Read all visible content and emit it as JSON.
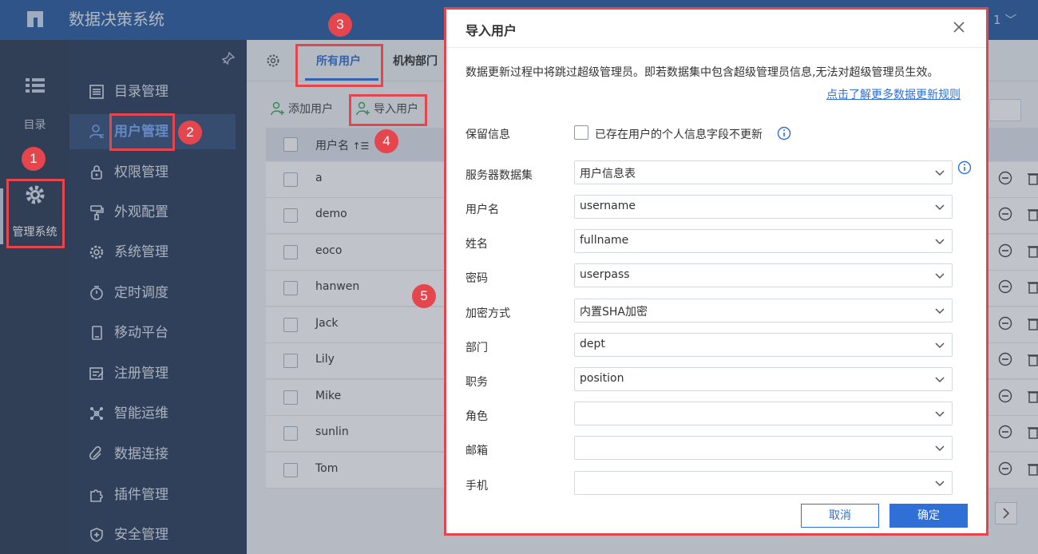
{
  "app": {
    "title": "数据决策系统",
    "user_menu": "1 ﹀"
  },
  "rail": {
    "directory_label": "目录",
    "manage_label": "管理系统"
  },
  "sidebar": {
    "items": [
      {
        "label": "目录管理",
        "icon": "list-icon"
      },
      {
        "label": "用户管理",
        "icon": "user-icon",
        "active": true
      },
      {
        "label": "权限管理",
        "icon": "lock-icon"
      },
      {
        "label": "外观配置",
        "icon": "brush-icon"
      },
      {
        "label": "系统管理",
        "icon": "gear-icon"
      },
      {
        "label": "定时调度",
        "icon": "timer-icon"
      },
      {
        "label": "移动平台",
        "icon": "mobile-icon"
      },
      {
        "label": "注册管理",
        "icon": "register-icon"
      },
      {
        "label": "智能运维",
        "icon": "network-icon"
      },
      {
        "label": "数据连接",
        "icon": "link-icon"
      },
      {
        "label": "插件管理",
        "icon": "puzzle-icon"
      },
      {
        "label": "安全管理",
        "icon": "shield-icon"
      }
    ]
  },
  "main": {
    "tabs": [
      {
        "label": "所有用户"
      },
      {
        "label": "机构部门"
      }
    ],
    "toolbar": {
      "add_user": "添加用户",
      "import_user": "导入用户"
    },
    "table": {
      "header": "用户名",
      "rows": [
        "a",
        "demo",
        "eoco",
        "hanwen",
        "Jack",
        "Lily",
        "Mike",
        "sunlin",
        "Tom"
      ]
    }
  },
  "dialog": {
    "title": "导入用户",
    "note": "数据更新过程中将跳过超级管理员。即若数据集中包含超级管理员信息,无法对超级管理员生效。",
    "link": "点击了解更多数据更新规则",
    "keep_label": "保留信息",
    "keep_text": "已存在用户的个人信息字段不更新",
    "fields": [
      {
        "label": "服务器数据集",
        "value": "用户信息表"
      },
      {
        "label": "用户名",
        "value": "username"
      },
      {
        "label": "姓名",
        "value": "fullname"
      },
      {
        "label": "密码",
        "value": "userpass"
      },
      {
        "label": "加密方式",
        "value": "内置SHA加密"
      },
      {
        "label": "部门",
        "value": "dept"
      },
      {
        "label": "职务",
        "value": "position"
      },
      {
        "label": "角色",
        "value": ""
      },
      {
        "label": "邮箱",
        "value": ""
      },
      {
        "label": "手机",
        "value": ""
      }
    ],
    "cancel": "取消",
    "ok": "确定"
  },
  "callouts": [
    "1",
    "2",
    "3",
    "4",
    "5"
  ],
  "colors": {
    "accent": "#2f6fd6",
    "highlight": "#e5454c",
    "topbar": "#2a5ba0",
    "sidebar": "#2d3d5a"
  }
}
